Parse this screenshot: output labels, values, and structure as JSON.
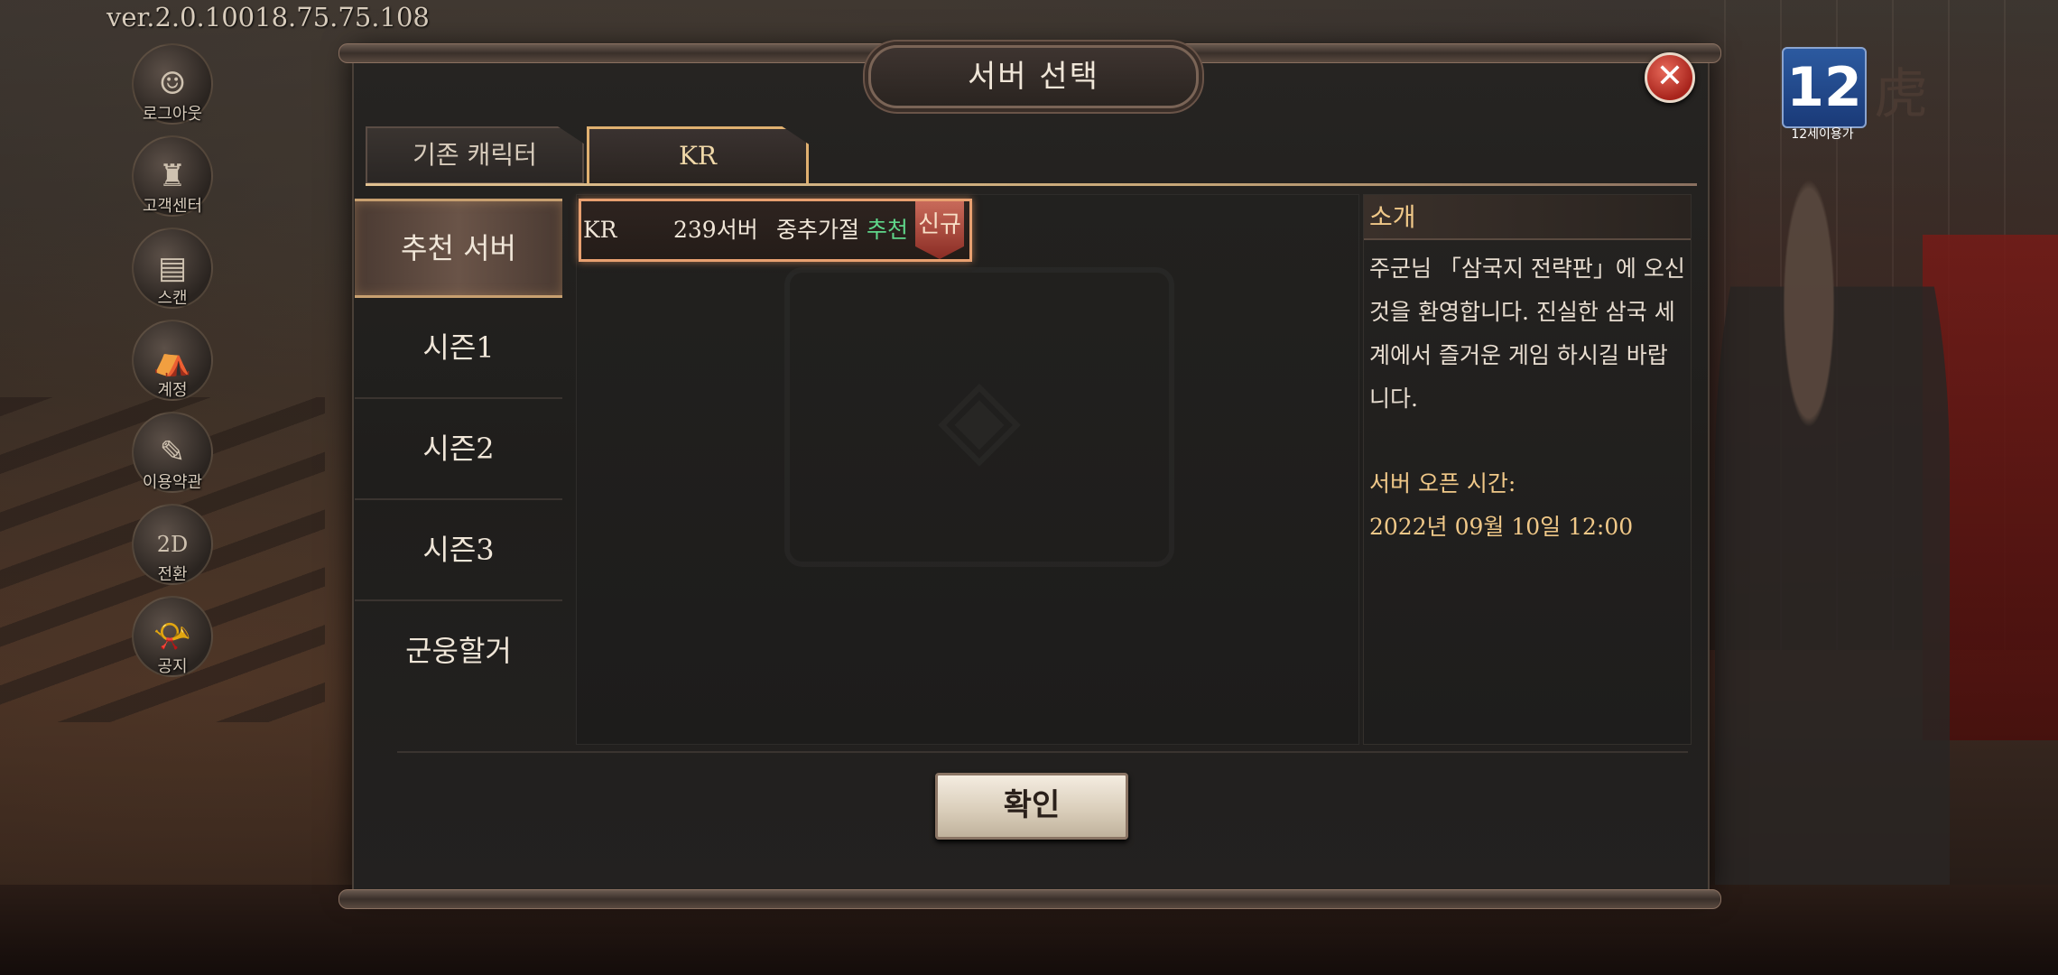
{
  "version": "ver.2.0.10018.75.75.108",
  "side_menu": [
    {
      "label": "로그아웃",
      "icon": "person-icon"
    },
    {
      "label": "고객센터",
      "icon": "helmet-icon"
    },
    {
      "label": "스캔",
      "icon": "scan-icon"
    },
    {
      "label": "계정",
      "icon": "account-icon"
    },
    {
      "label": "이용약관",
      "icon": "pen-icon"
    },
    {
      "label": "전환",
      "icon": "2d-3d-icon"
    },
    {
      "label": "공지",
      "icon": "horn-icon"
    }
  ],
  "rating": {
    "age": "12",
    "caption": "12세이용가",
    "logo_char": "虎"
  },
  "dialog": {
    "title": "서버 선택",
    "close_label": "✕",
    "tabs": [
      {
        "label": "기존 캐릭터",
        "active": false
      },
      {
        "label": "KR",
        "active": true
      }
    ],
    "nav": [
      {
        "label": "추천 서버",
        "active": true
      },
      {
        "label": "시즌1",
        "active": false
      },
      {
        "label": "시즌2",
        "active": false
      },
      {
        "label": "시즌3",
        "active": false
      },
      {
        "label": "군웅할거",
        "active": false
      }
    ],
    "servers": [
      {
        "region": "KR",
        "name": "239서버",
        "status": "중추가절",
        "tag": "추천",
        "badge": "신규"
      }
    ],
    "info": {
      "heading": "소개",
      "intro": "주군님 「삼국지 전략판」에 오신 것을 환영합니다. 진실한 삼국 세계에서 즐거운 게임 하시길 바랍니다.",
      "open_label": "서버 오픈 시간:",
      "open_time": "2022년 09월 10일 12:00"
    },
    "confirm_label": "확인"
  },
  "colors": {
    "accent": "#e0b070",
    "recommend": "#5fd68a",
    "gold_text": "#f0c888"
  }
}
